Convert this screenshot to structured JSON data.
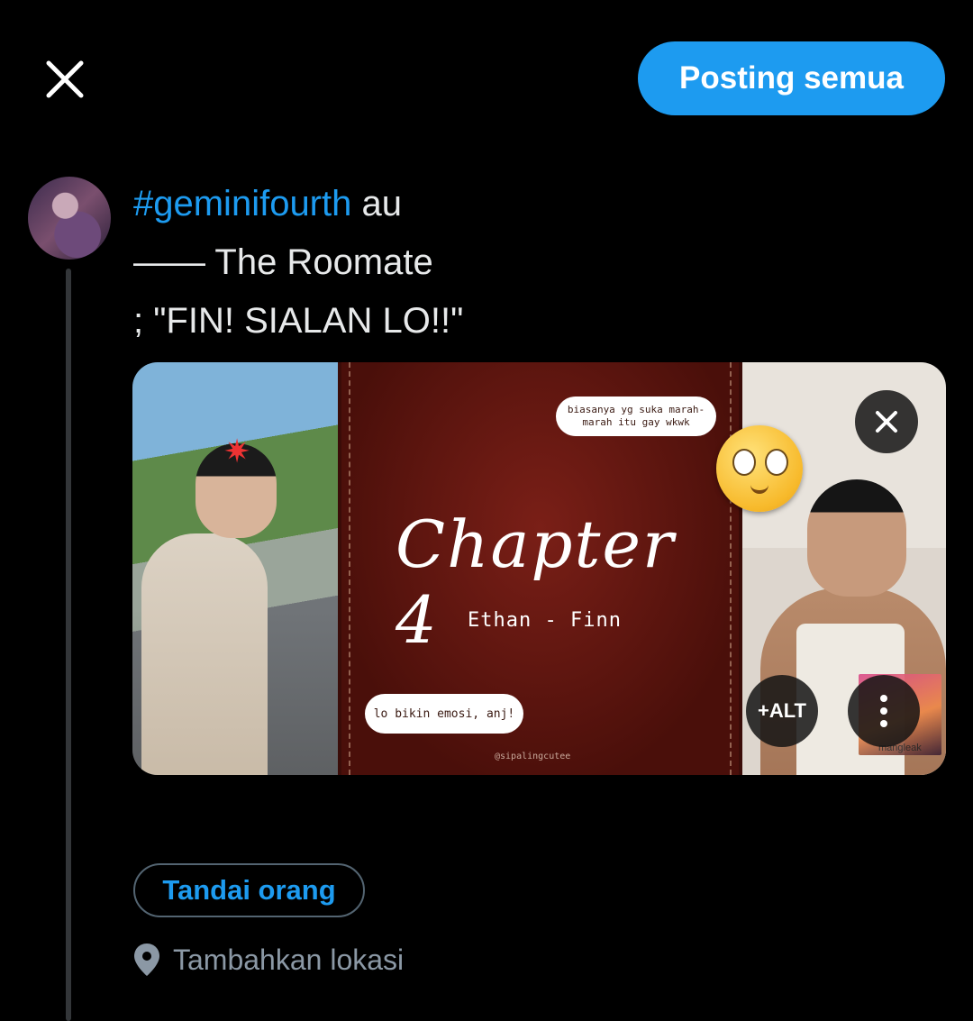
{
  "header": {
    "post_all_label": "Posting semua",
    "close_icon": "close-icon"
  },
  "tweet": {
    "hashtag": "#geminifourth",
    "line1_rest": " au",
    "line2": "—— The Roomate",
    "line3": "; \"FIN! SIALAN LO!!\""
  },
  "media": {
    "bubble_top": "biasanya yg suka marah-marah itu gay wkwk",
    "chapter_title": "Chapter 4",
    "chapter_names": "Ethan - Finn",
    "bubble_bottom": "lo bikin emosi, anj!",
    "credit": "@sipalingcutee",
    "sticker_text": "mangleak",
    "alt_label": "+ALT"
  },
  "actions": {
    "tag_people": "Tandai orang",
    "add_location": "Tambahkan lokasi"
  },
  "colors": {
    "accent": "#1d9bf0",
    "background": "#000000",
    "muted": "#8b98a5"
  }
}
